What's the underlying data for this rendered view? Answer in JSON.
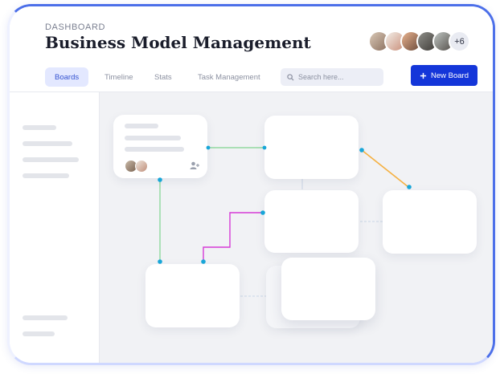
{
  "header": {
    "eyebrow": "DASHBOARD",
    "title": "Business Model Management",
    "avatar_overflow": "+6"
  },
  "tabs": [
    {
      "label": "Boards",
      "active": true
    },
    {
      "label": "Timeline",
      "active": false
    },
    {
      "label": "Stats",
      "active": false
    },
    {
      "label": "Task Management",
      "active": false
    }
  ],
  "search": {
    "placeholder": "Search here..."
  },
  "new_board": {
    "label": "New Board",
    "icon": "plus-icon"
  },
  "colors": {
    "accent": "#1436d9",
    "tab_active_bg": "#e3e8ff",
    "link_green": "#7fd48f",
    "link_orange": "#f5b040",
    "link_magenta": "#d63ad6",
    "node_dot": "#18a6d8"
  }
}
